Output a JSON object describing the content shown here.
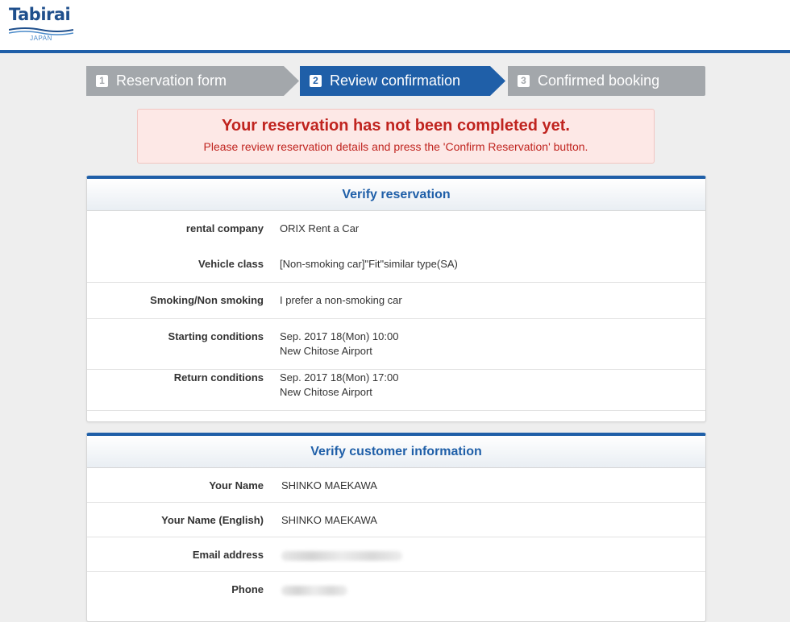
{
  "logo": {
    "name": "Tabirai",
    "sub": "JAPAN"
  },
  "steps": [
    {
      "num": "1",
      "label": "Reservation form"
    },
    {
      "num": "2",
      "label": "Review confirmation"
    },
    {
      "num": "3",
      "label": "Confirmed booking"
    }
  ],
  "alert": {
    "title": "Your reservation has not been completed yet.",
    "message": "Please review reservation details and press the 'Confirm Reservation' button."
  },
  "reservation": {
    "title": "Verify reservation",
    "rows": [
      {
        "label": "rental company",
        "value": "ORIX Rent a Car"
      },
      {
        "label": "Vehicle class",
        "value": "[Non-smoking car]\"Fit\"similar type(SA)"
      },
      {
        "label": "Smoking/Non smoking",
        "value": "I prefer a non-smoking car"
      },
      {
        "label": "Starting conditions",
        "value": "Sep. 2017 18(Mon) 10:00",
        "value2": "New Chitose Airport"
      },
      {
        "label": "Return conditions",
        "value": "Sep. 2017 18(Mon) 17:00",
        "value2": "New Chitose Airport"
      }
    ]
  },
  "customer": {
    "title": "Verify customer information",
    "rows": [
      {
        "label": "Your Name",
        "value": "SHINKO MAEKAWA"
      },
      {
        "label": "Your Name (English)",
        "value": "SHINKO MAEKAWA"
      },
      {
        "label": "Email address",
        "value": ""
      },
      {
        "label": "Phone",
        "value": ""
      }
    ]
  },
  "colors": {
    "brand": "#1f5fa8",
    "error": "#c0241f",
    "step_inactive": "#a3a7ab"
  }
}
